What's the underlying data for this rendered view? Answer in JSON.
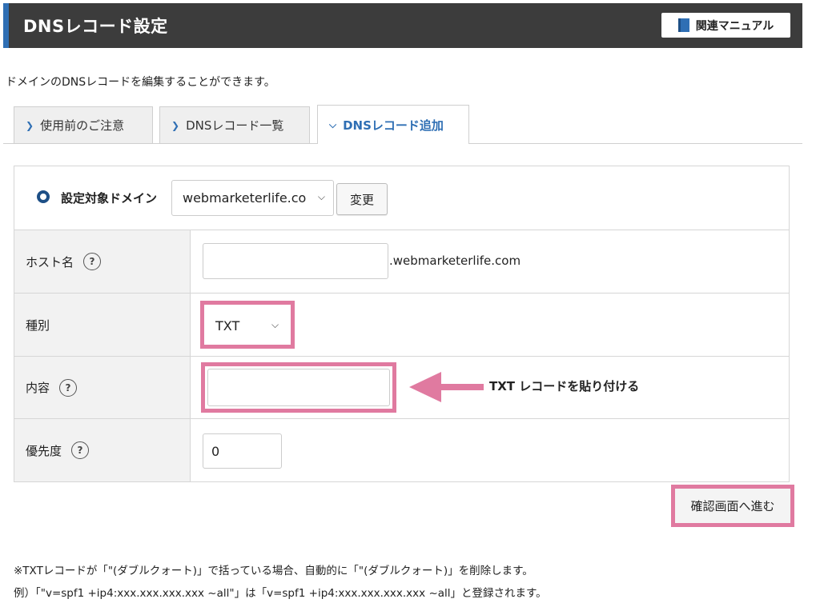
{
  "header": {
    "title": "DNSレコード設定",
    "manual_button": "関連マニュアル"
  },
  "description": "ドメインのDNSレコードを編集することができます。",
  "tabs": [
    {
      "label": "使用前のご注意"
    },
    {
      "label": "DNSレコード一覧"
    },
    {
      "label": "DNSレコード追加"
    }
  ],
  "form": {
    "domain_label": "設定対象ドメイン",
    "domain_value": "webmarketerlife.co",
    "change_button": "変更",
    "host": {
      "label": "ホスト名",
      "value": "",
      "suffix": ".webmarketerlife.com"
    },
    "type": {
      "label": "種別",
      "value": "TXT"
    },
    "content": {
      "label": "内容",
      "value": "",
      "annotation": "TXT レコードを貼り付ける"
    },
    "priority": {
      "label": "優先度",
      "value": "0"
    }
  },
  "confirm_button": "確認画面へ進む",
  "notes": [
    "※TXTレコードが「\"(ダブルクォート)」で括っている場合、自動的に「\"(ダブルクォート)」を削除します。",
    "例）「\"v=spf1 +ip4:xxx.xxx.xxx.xxx ~all\"」は「v=spf1 +ip4:xxx.xxx.xxx.xxx ~all」と登録されます。"
  ],
  "colors": {
    "header_bg": "#3c3c3c",
    "accent_blue": "#2f6fb4",
    "highlight_pink": "#e07aa0"
  }
}
